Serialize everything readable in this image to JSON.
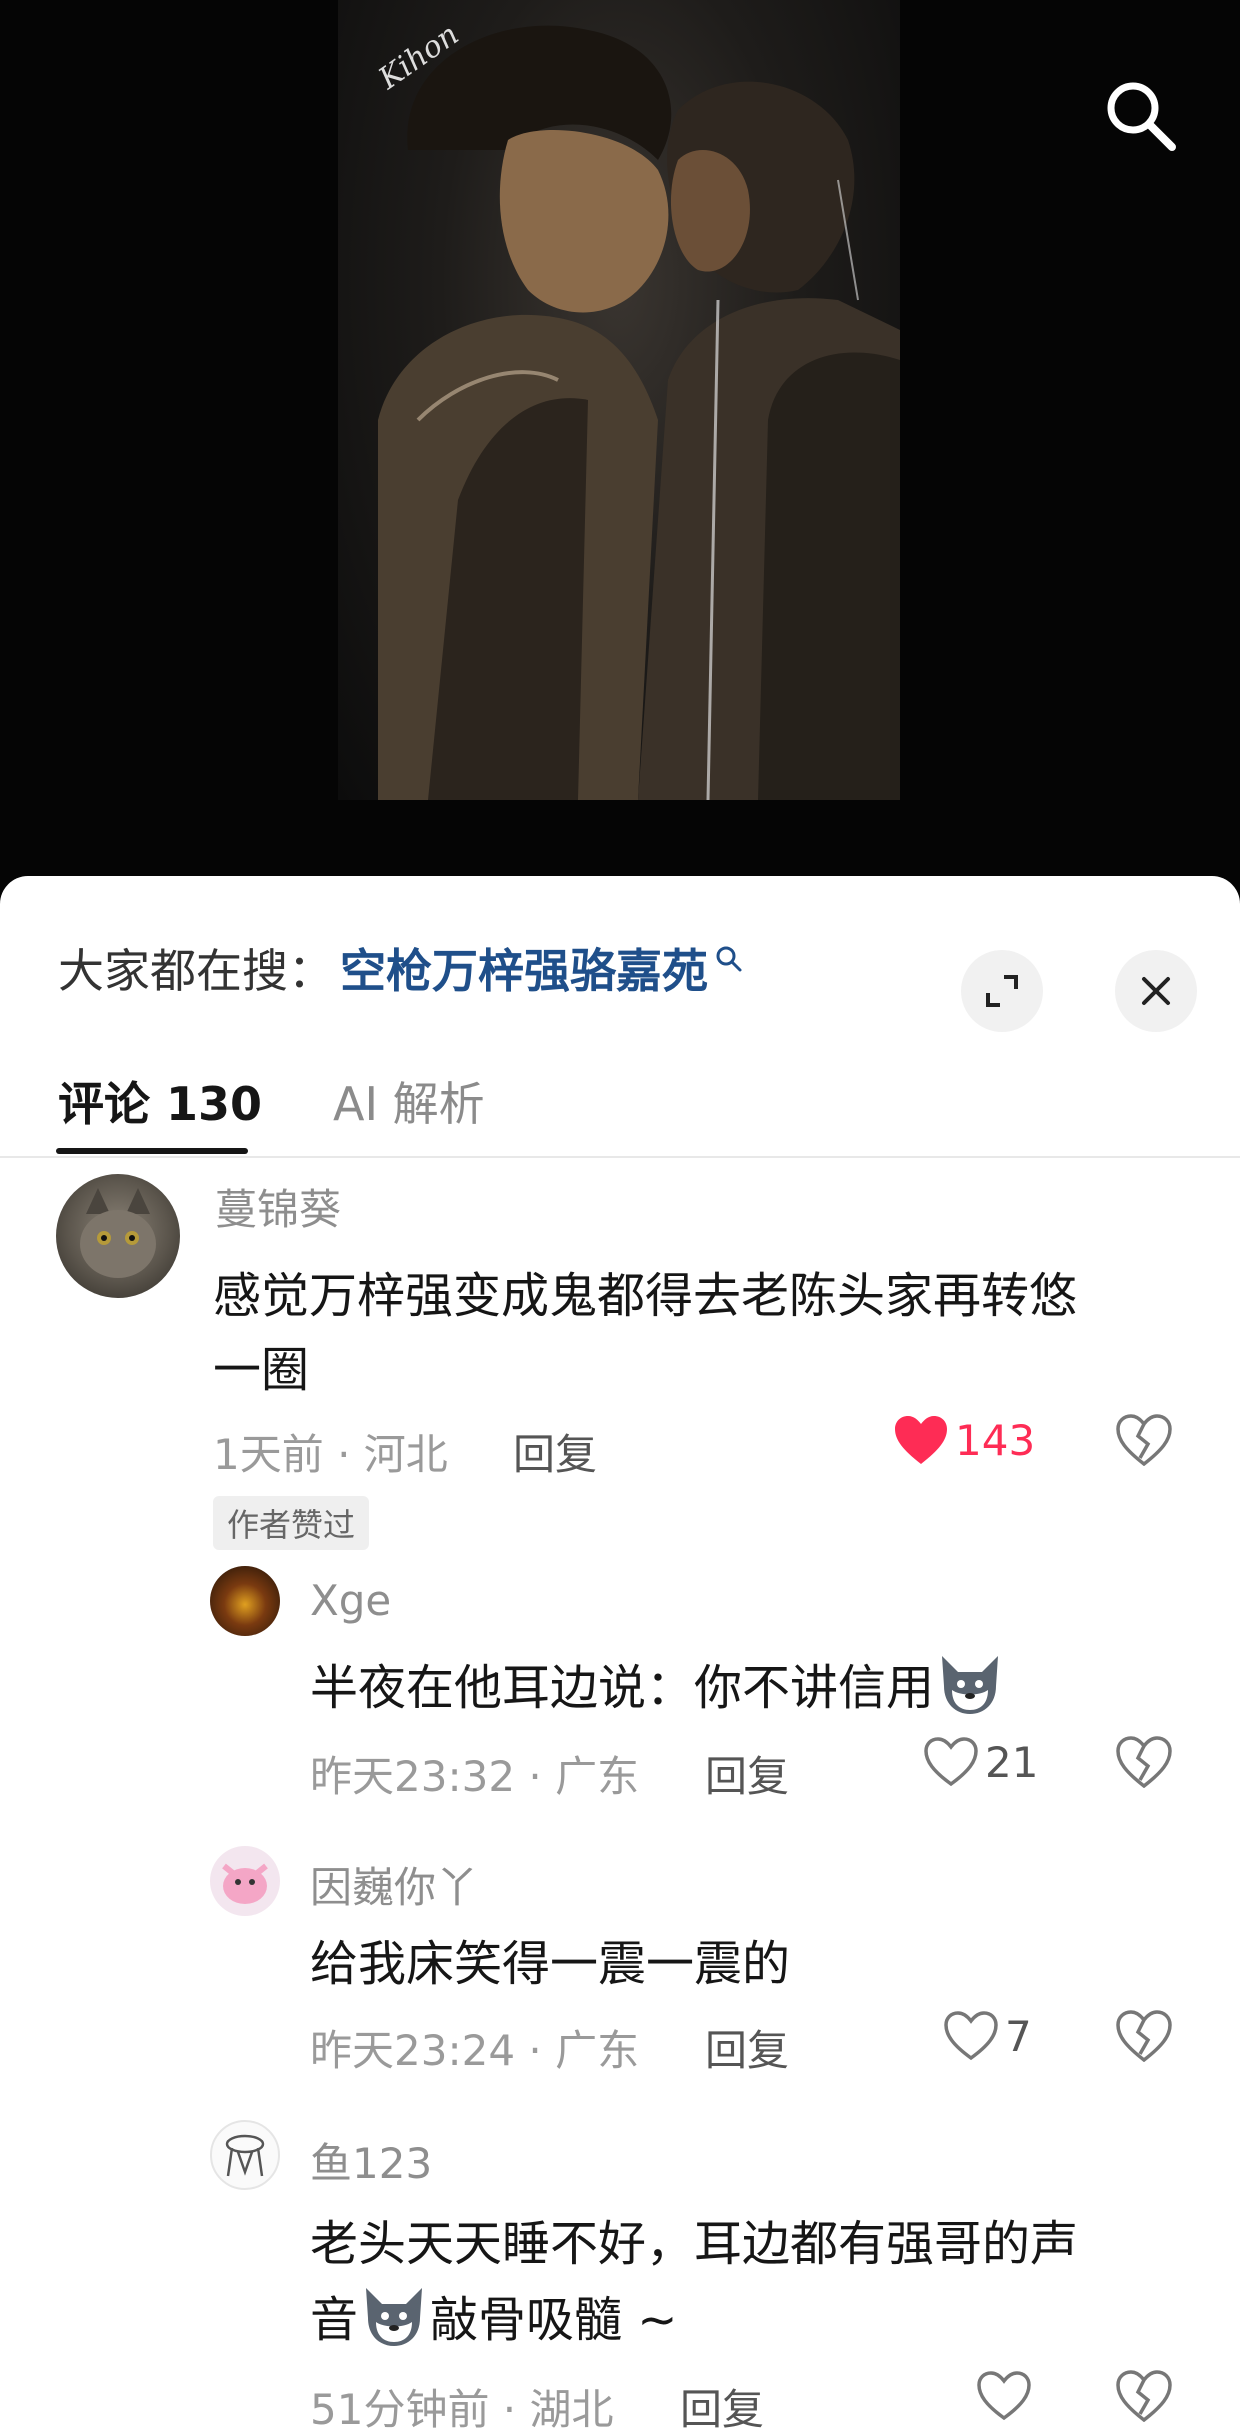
{
  "hero": {
    "signature": "Kihon"
  },
  "search_bar": {
    "prefix": "大家都在搜：",
    "query": "空枪万梓强骆嘉苑"
  },
  "tabs": [
    {
      "label": "评论 130"
    },
    {
      "label": "AI 解析"
    }
  ],
  "comments": [
    {
      "username": "蔓锦葵",
      "text_line1": "感觉万梓强变成鬼都得去老陈头家再转悠",
      "text_line2": "一圈",
      "meta": "1天前 · 河北",
      "reply_label": "回复",
      "likes": "143",
      "badge": "作者赞过"
    },
    {
      "username": "Xge",
      "text": "半夜在他耳边说：你不讲信用",
      "meta": "昨天23:32 · 广东",
      "reply_label": "回复",
      "likes": "21"
    },
    {
      "username": "因巍你丫",
      "text": "给我床笑得一震一震的",
      "meta": "昨天23:24 · 广东",
      "reply_label": "回复",
      "likes": "7"
    },
    {
      "username": "鱼123",
      "text_line1": "老头天天睡不好，耳边都有强哥的声",
      "text_line2_a": "音",
      "text_line2_b": "敲骨吸髓 ~",
      "meta": "51分钟前 · 湖北",
      "reply_label": "回复"
    }
  ],
  "colors": {
    "accent_like": "#fe2c55",
    "query_blue": "#1f4f8a"
  }
}
